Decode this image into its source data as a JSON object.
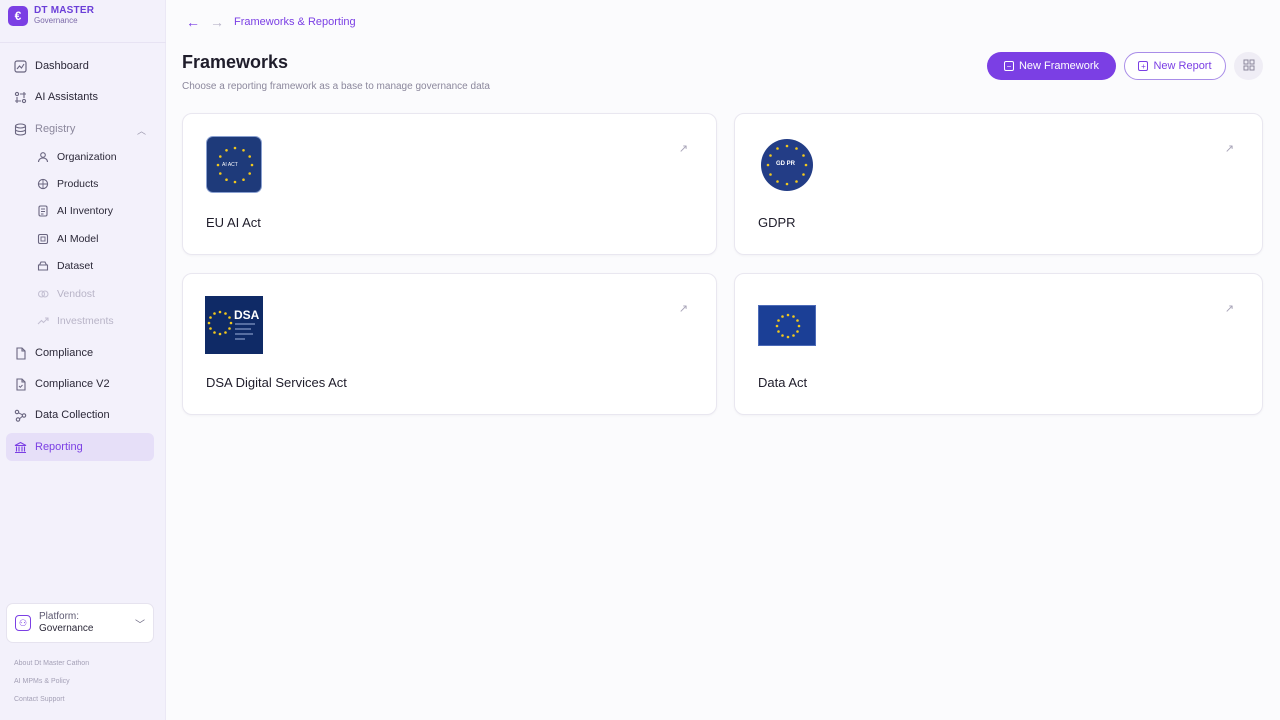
{
  "brand": {
    "name": "DT MASTER",
    "subtitle": "Governance"
  },
  "sidebar": {
    "items": [
      {
        "label": "Dashboard",
        "icon": "dashboard-icon"
      },
      {
        "label": "AI Assistants",
        "icon": "ai-assistants-icon"
      },
      {
        "label": "Registry",
        "icon": "database-icon"
      },
      {
        "label": "Organization",
        "icon": "user-icon"
      },
      {
        "label": "Products",
        "icon": "box-icon"
      },
      {
        "label": "AI Inventory",
        "icon": "inventory-icon"
      },
      {
        "label": "AI Model",
        "icon": "model-icon"
      },
      {
        "label": "Dataset",
        "icon": "dataset-icon"
      },
      {
        "label": "Vendost",
        "icon": "vendor-icon"
      },
      {
        "label": "Investments",
        "icon": "trend-icon"
      },
      {
        "label": "Compliance",
        "icon": "document-icon"
      },
      {
        "label": "Compliance V2",
        "icon": "document-check-icon"
      },
      {
        "label": "Data Collection",
        "icon": "data-collection-icon"
      },
      {
        "label": "Reporting",
        "icon": "bank-icon"
      }
    ],
    "platform": {
      "label": "Platform:",
      "value": "Governance"
    },
    "footer_links": [
      "About Dt Master Cathon",
      "AI MPMs & Policy",
      "Contact Support"
    ]
  },
  "breadcrumb": {
    "current": "Frameworks & Reporting"
  },
  "page": {
    "title": "Frameworks",
    "subtitle": "Choose a reporting framework as a base to manage governance data"
  },
  "actions": {
    "new_framework": "New Framework",
    "new_report": "New Report"
  },
  "frameworks": [
    {
      "title": "EU AI Act",
      "logo_text": "AI ACT"
    },
    {
      "title": "GDPR",
      "logo_text": "GD PR"
    },
    {
      "title": "DSA Digital Services Act",
      "logo_text": "DSA"
    },
    {
      "title": "Data Act",
      "logo_text": ""
    }
  ],
  "colors": {
    "accent": "#7b3fe4",
    "sidebar_bg": "#f3f1fb",
    "active_bg": "#e6dff8",
    "eu_blue": "#1e3a7a",
    "eu_star": "#f2c81c"
  }
}
